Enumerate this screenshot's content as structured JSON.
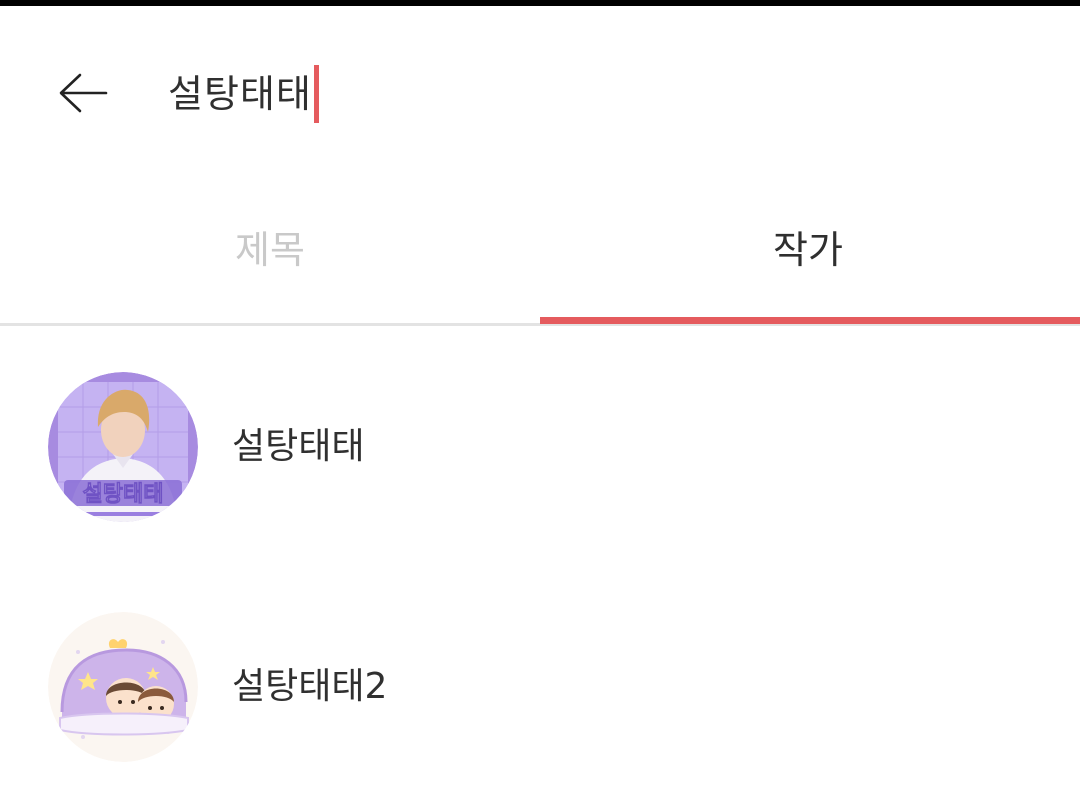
{
  "search": {
    "query": "설탕태태"
  },
  "tabs": [
    {
      "label": "제목",
      "active": false
    },
    {
      "label": "작가",
      "active": true
    }
  ],
  "results": [
    {
      "name": "설탕태태",
      "avatar_caption": "설탕태태"
    },
    {
      "name": "설탕태태2"
    }
  ],
  "colors": {
    "accent": "#e55b5e",
    "text_primary": "#303030",
    "text_inactive": "#c9c9c9",
    "divider": "#e3e3e3",
    "avatar1_bg": "#a78be0",
    "avatar2_bg": "#fbf6f1"
  },
  "icons": {
    "back": "arrow-left-icon"
  }
}
